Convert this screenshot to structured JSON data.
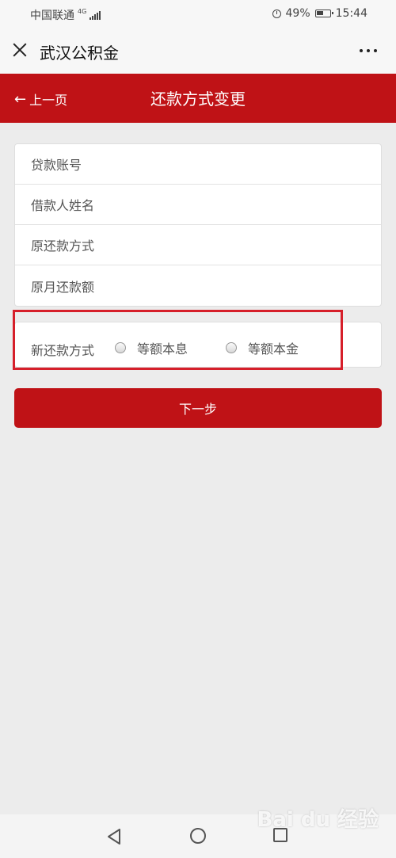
{
  "status_bar": {
    "carrier": "中国联通",
    "network": "4G",
    "battery": "49%",
    "time": "15:44"
  },
  "wechat_header": {
    "title": "武汉公积金"
  },
  "page_header": {
    "back_label": "上一页",
    "title": "还款方式变更",
    "color": "#bf1216"
  },
  "form": {
    "fields": [
      {
        "placeholder": "贷款账号"
      },
      {
        "placeholder": "借款人姓名"
      },
      {
        "placeholder": "原还款方式"
      },
      {
        "placeholder": "原月还款额"
      }
    ],
    "new_method": {
      "label": "新还款方式",
      "options": [
        "等额本息",
        "等额本金"
      ]
    },
    "next_button": "下一步"
  },
  "watermark": "Bai du 经验"
}
